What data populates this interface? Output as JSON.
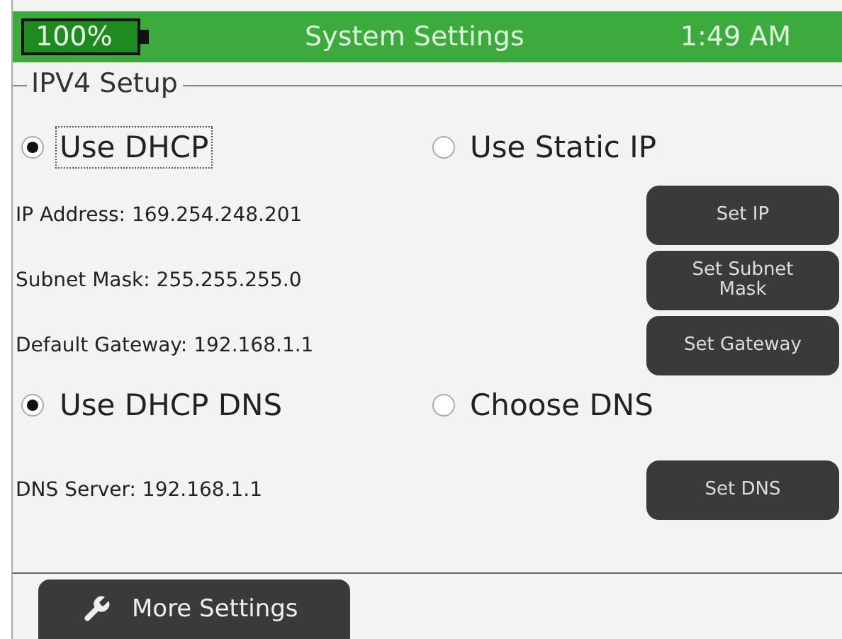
{
  "status_bar": {
    "battery": "100%",
    "title": "System Settings",
    "time": "1:49 AM"
  },
  "group": {
    "title": "IPV4 Setup"
  },
  "ip_mode": [
    {
      "label": "Use DHCP",
      "selected": true,
      "focused": true
    },
    {
      "label": "Use Static IP",
      "selected": false,
      "focused": false
    }
  ],
  "fields": [
    {
      "label": "IP Address: 169.254.248.201",
      "button": "Set IP"
    },
    {
      "label": "Subnet Mask: 255.255.255.0",
      "button": "Set Subnet Mask"
    },
    {
      "label": "Default Gateway: 192.168.1.1",
      "button": "Set Gateway"
    }
  ],
  "dns_mode": [
    {
      "label": "Use DHCP DNS",
      "selected": true
    },
    {
      "label": "Choose DNS",
      "selected": false
    }
  ],
  "dns": {
    "label": "DNS Server: 192.168.1.1",
    "button": "Set DNS"
  },
  "footer": {
    "button": "More Settings"
  }
}
